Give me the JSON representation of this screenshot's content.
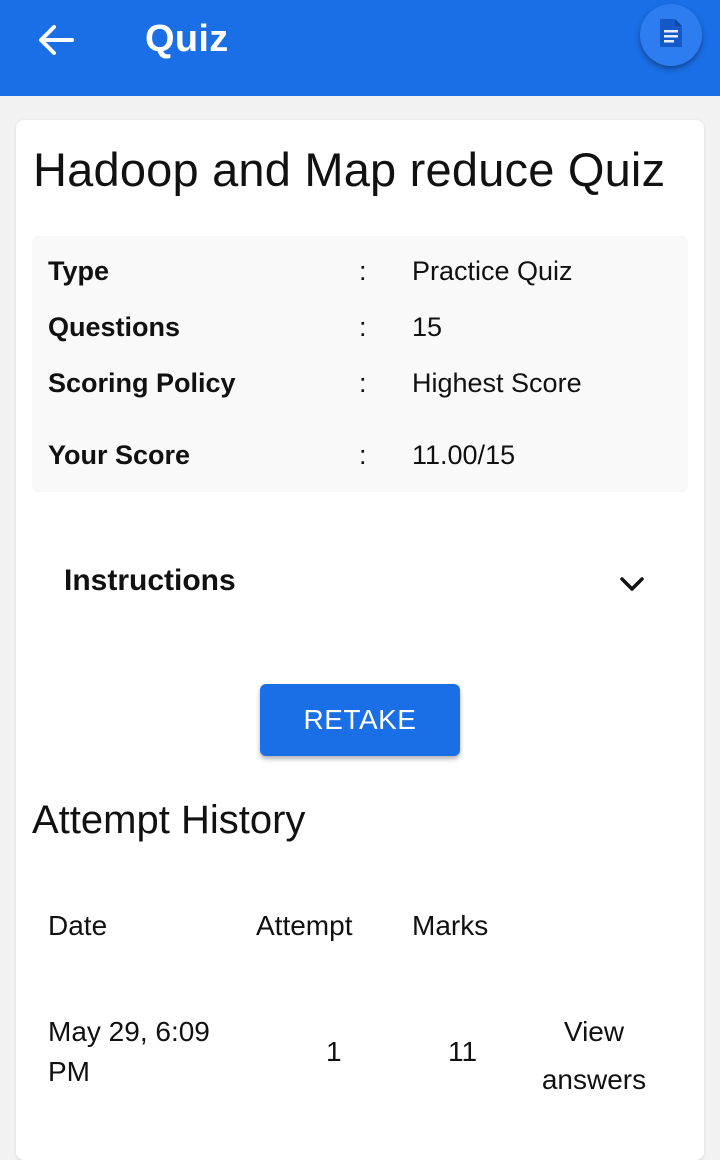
{
  "appbar": {
    "title": "Quiz",
    "back_icon": "arrow-left-icon",
    "action_icon": "document-icon",
    "color": "#1a6fe6"
  },
  "quiz": {
    "title": "Hadoop and Map reduce Quiz",
    "info": [
      {
        "label": "Type",
        "separator": ":",
        "value": "Practice Quiz"
      },
      {
        "label": "Questions",
        "separator": ":",
        "value": "15"
      },
      {
        "label": "Scoring Policy",
        "separator": ":",
        "value": "Highest Score"
      },
      {
        "label": "Your Score",
        "separator": ":",
        "value": "11.00/15"
      }
    ],
    "instructions_label": "Instructions",
    "instructions_icon": "chevron-down-icon",
    "retake_label": "RETAKE"
  },
  "history": {
    "title": "Attempt History",
    "columns": [
      "Date",
      "Attempt",
      "Marks"
    ],
    "rows": [
      {
        "date_line1": "May 29, 6:09",
        "date_line2": "PM",
        "attempt": "1",
        "marks": "11",
        "action_line1": "View",
        "action_line2": "answers"
      }
    ]
  }
}
